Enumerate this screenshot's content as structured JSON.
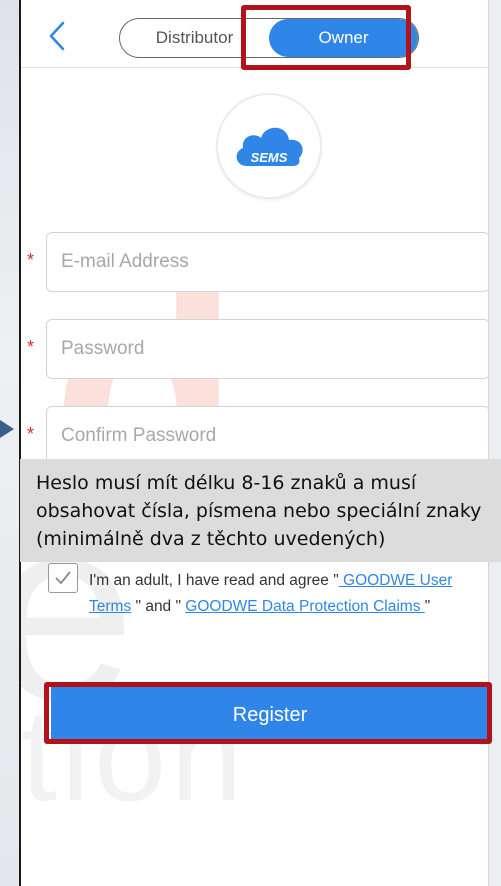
{
  "header": {
    "back_icon": "chevron-left-icon",
    "tabs": [
      {
        "label": "Distributor",
        "active": false
      },
      {
        "label": "Owner",
        "active": true
      }
    ]
  },
  "logo": {
    "text": "SEMS",
    "icon": "cloud-icon",
    "color": "#2f86e8"
  },
  "form": {
    "fields": [
      {
        "placeholder": "E-mail Address",
        "value": "",
        "required": true
      },
      {
        "placeholder": "Password",
        "value": "",
        "required": true
      },
      {
        "placeholder": "Confirm Password",
        "value": "",
        "required": true
      }
    ],
    "required_mark": "*"
  },
  "tooltip": {
    "line1": "Heslo musí mít délku 8-16 znaků a musí",
    "line2": "obsahovat čísla, písmena nebo speciální znaky",
    "line3": "(minimálně dva z těchto uvedených)"
  },
  "terms": {
    "checked": true,
    "prefix": "I'm an adult, I have read and agree \"",
    "link1": " GOODWE User Terms",
    "middle": " \" and \" ",
    "link2": "GOODWE Data Protection Claims ",
    "suffix": "\""
  },
  "register": {
    "label": "Register"
  },
  "watermark": {
    "letter1": "d",
    "letter2": "e",
    "fragment": "tion"
  },
  "colors": {
    "accent": "#2f86e8",
    "highlight": "#b1121b",
    "required": "#e22b2b"
  }
}
